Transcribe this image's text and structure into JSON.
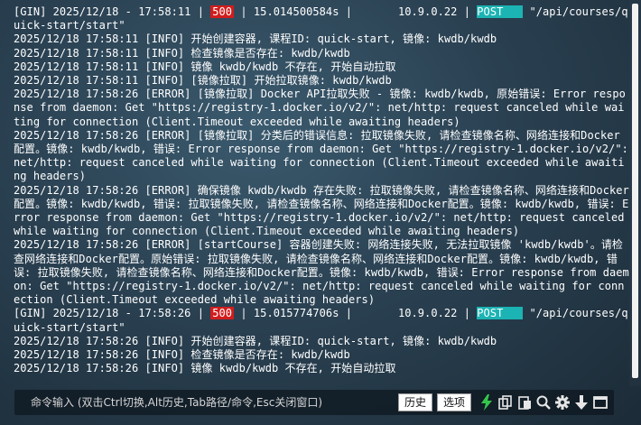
{
  "log": {
    "lines": [
      {
        "type": "gin",
        "prefix": "[GIN] 2025/12/18 - 17:58:11 |",
        "status": "500",
        "mid": "| 15.014500584s |       10.9.0.22 |",
        "method": "POST   ",
        "path": "\"/api/courses/quick-start/start\""
      },
      {
        "type": "text",
        "text": "2025/12/18 17:58:11 [INFO] 开始创建容器, 课程ID: quick-start, 镜像: kwdb/kwdb"
      },
      {
        "type": "text",
        "text": "2025/12/18 17:58:11 [INFO] 检查镜像是否存在: kwdb/kwdb"
      },
      {
        "type": "text",
        "text": "2025/12/18 17:58:11 [INFO] 镜像 kwdb/kwdb 不存在, 开始自动拉取"
      },
      {
        "type": "text",
        "text": "2025/12/18 17:58:11 [INFO] [镜像拉取] 开始拉取镜像: kwdb/kwdb"
      },
      {
        "type": "text",
        "text": "2025/12/18 17:58:26 [ERROR] [镜像拉取] Docker API拉取失败 - 镜像: kwdb/kwdb, 原始错误: Error response from daemon: Get \"https://registry-1.docker.io/v2/\": net/http: request canceled while waiting for connection (Client.Timeout exceeded while awaiting headers)"
      },
      {
        "type": "text",
        "text": "2025/12/18 17:58:26 [ERROR] [镜像拉取] 分类后的错误信息: 拉取镜像失败, 请检查镜像名称、网络连接和Docker配置。镜像: kwdb/kwdb, 错误: Error response from daemon: Get \"https://registry-1.docker.io/v2/\": net/http: request canceled while waiting for connection (Client.Timeout exceeded while awaiting headers)"
      },
      {
        "type": "text",
        "text": "2025/12/18 17:58:26 [ERROR] 确保镜像 kwdb/kwdb 存在失败: 拉取镜像失败, 请检查镜像名称、网络连接和Docker配置。镜像: kwdb/kwdb, 错误: 拉取镜像失败, 请检查镜像名称、网络连接和Docker配置。镜像: kwdb/kwdb, 错误: Error response from daemon: Get \"https://registry-1.docker.io/v2/\": net/http: request canceled while waiting for connection (Client.Timeout exceeded while awaiting headers)"
      },
      {
        "type": "text",
        "text": "2025/12/18 17:58:26 [ERROR] [startCourse] 容器创建失败: 网络连接失败, 无法拉取镜像 'kwdb/kwdb'。请检查网络连接和Docker配置。原始错误: 拉取镜像失败, 请检查镜像名称、网络连接和Docker配置。镜像: kwdb/kwdb, 错误: 拉取镜像失败, 请检查镜像名称、网络连接和Docker配置。镜像: kwdb/kwdb, 错误: Error response from daemon: Get \"https://registry-1.docker.io/v2/\": net/http: request canceled while waiting for connection (Client.Timeout exceeded while awaiting headers)"
      },
      {
        "type": "gin",
        "prefix": "[GIN] 2025/12/18 - 17:58:26 |",
        "status": "500",
        "mid": "| 15.015774706s |       10.9.0.22 |",
        "method": "POST   ",
        "path": "\"/api/courses/quick-start/start\""
      },
      {
        "type": "text",
        "text": "2025/12/18 17:58:26 [INFO] 开始创建容器, 课程ID: quick-start, 镜像: kwdb/kwdb"
      },
      {
        "type": "text",
        "text": "2025/12/18 17:58:26 [INFO] 检查镜像是否存在: kwdb/kwdb"
      },
      {
        "type": "text",
        "text": "2025/12/18 17:58:26 [INFO] 镜像 kwdb/kwdb 不存在, 开始自动拉取"
      }
    ]
  },
  "command_bar": {
    "placeholder": "命令输入 (双击Ctrl切换,Alt历史,Tab路径/命令,Esc关闭窗口)",
    "history_label": "历史",
    "options_label": "选项"
  },
  "colors": {
    "status_500": "#d11d1d",
    "method_post": "#1bb3b3",
    "lightning_icon": "#34c84a"
  },
  "icons": [
    "lightning-icon",
    "copy-icon",
    "paste-icon",
    "search-icon",
    "gear-icon",
    "arrow-down-icon",
    "window-icon"
  ]
}
